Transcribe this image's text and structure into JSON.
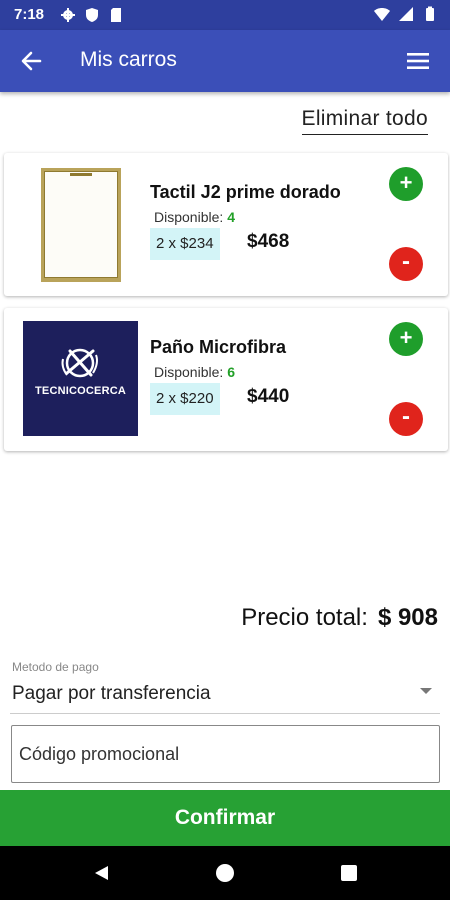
{
  "status_bar": {
    "time": "7:18"
  },
  "app_bar": {
    "title": "Mis carros"
  },
  "clear_all_label": "Eliminar todo",
  "items": [
    {
      "name": "Tactil J2 prime dorado",
      "available_label": "Disponible:",
      "available": "4",
      "quantity_price": "2 x $234",
      "subtotal": "$468",
      "plus": "+",
      "minus": "-"
    },
    {
      "name": "Paño Microfibra",
      "available_label": "Disponible:",
      "available": "6",
      "quantity_price": "2 x $220",
      "subtotal": "$440",
      "plus": "+",
      "minus": "-",
      "brand": "TECNICOCERCA"
    }
  ],
  "total": {
    "label": "Precio total:",
    "value": "$ 908"
  },
  "payment": {
    "label": "Metodo de pago",
    "value": "Pagar por transferencia"
  },
  "promo": {
    "placeholder": "Código promocional"
  },
  "confirm_label": "Confirmar",
  "colors": {
    "primary": "#3b4fb8",
    "status_bar": "#2e3f9e",
    "accent_green": "#27a134",
    "danger_red": "#e0241c",
    "badge_bg": "#d3f4f7"
  }
}
